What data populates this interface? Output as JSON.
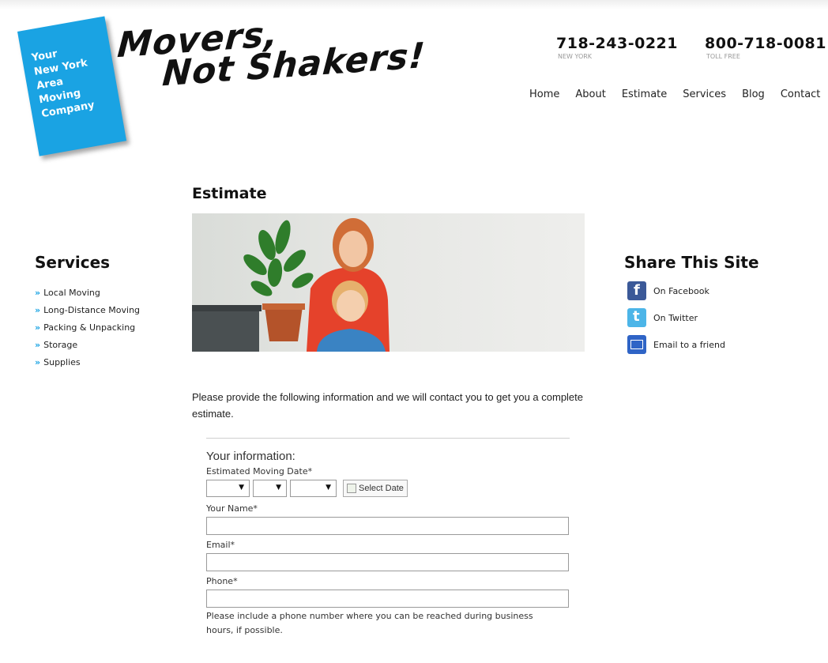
{
  "header": {
    "badge_text": "Your\nNew York\nArea\nMoving\nCompany",
    "slogan_line1": "Movers,",
    "slogan_line2": "Not Shakers!",
    "phones": [
      {
        "number": "718-243-0221",
        "label": "NEW YORK"
      },
      {
        "number": "800-718-0081",
        "label": "TOLL FREE"
      }
    ],
    "nav": [
      "Home",
      "About",
      "Estimate",
      "Services",
      "Blog",
      "Contact"
    ]
  },
  "sidebar": {
    "title": "Services",
    "bullet": "»",
    "items": [
      "Local Moving",
      "Long-Distance Moving",
      "Packing & Unpacking",
      "Storage",
      "Supplies"
    ]
  },
  "main": {
    "title": "Estimate",
    "intro": "Please provide the following information and we will contact you to get you a complete estimate.",
    "form": {
      "heading": "Your information:",
      "moving_date_label": "Estimated Moving Date*",
      "select_date_label": "Select Date",
      "name_label": "Your Name*",
      "email_label": "Email*",
      "phone_label": "Phone*",
      "phone_help": "Please include a phone number where you can be reached during business hours, if possible."
    }
  },
  "share": {
    "title": "Share This Site",
    "items": [
      "On Facebook",
      "On Twitter",
      "Email to a friend"
    ]
  },
  "colors": {
    "accent": "#1aa3e3",
    "facebook": "#3b5998",
    "twitter": "#4cb5e8",
    "email": "#2f64c6"
  }
}
